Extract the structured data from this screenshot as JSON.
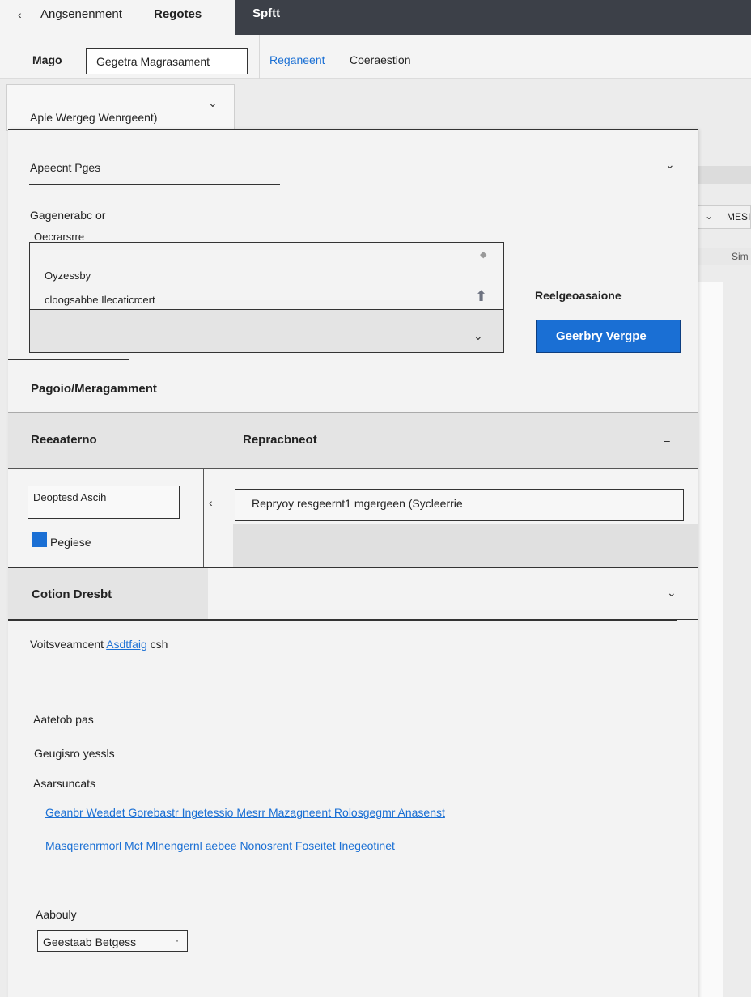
{
  "tabs": {
    "back_icon": "chevron-left-icon",
    "tab1": "Angsenenment",
    "tab2": "Regotes",
    "tab3": "Spftt"
  },
  "toolbar": {
    "label": "Mago",
    "selected": "Gegetra Magrasament",
    "link": "Reganeent",
    "text": "Coeraestion"
  },
  "dropdown": {
    "value": "Aple Wergeg Wenrgeent)"
  },
  "panel": {
    "field1_label": "Apeecnt Pges",
    "group_label": "Gagenerabc or",
    "box_title": "Oecrarsrre",
    "item1": "Oyzessby",
    "item2": "cloogsabbe Ilecaticrcert",
    "side_heading": "Reelgeoasaione",
    "primary_button": "Geerbry Vergpe",
    "section_title": "Pagoio/Meragamment",
    "col1": "Reeaaterno",
    "col2": "Repracbneot",
    "collapse_symbol": "–",
    "left_input": "Deoptesd Ascih",
    "checkbox_label": "Pegiese",
    "search_value": "Repryoy resgeernt1 mgergeen (Sycleerrie",
    "section2_title": "Cotion Dresbt",
    "field2_text": "Voitsveamcent",
    "field2_link": "Asdtfaig",
    "field2_suffix": "csh",
    "list_label1": "Aatetob pas",
    "list_label2": "Geugisro yessls",
    "list_label3": "Asarsuncats",
    "link1": "Geanbr Weadet Gorebastr Ingetessio Mesrr Mazagneent Rolosgegmr Anasenst",
    "link2": "Masqerenrmorl Mcf Mlnengernl aebee Nonosrent Foseitet Inegeotinet",
    "bottom_label": "Aabouly",
    "bottom_select": "Geestaab Betgess"
  },
  "bg": {
    "chip": "MESI",
    "sim": "Sim"
  },
  "colors": {
    "accent": "#1a6fd4",
    "tabbar": "#3c4048"
  }
}
